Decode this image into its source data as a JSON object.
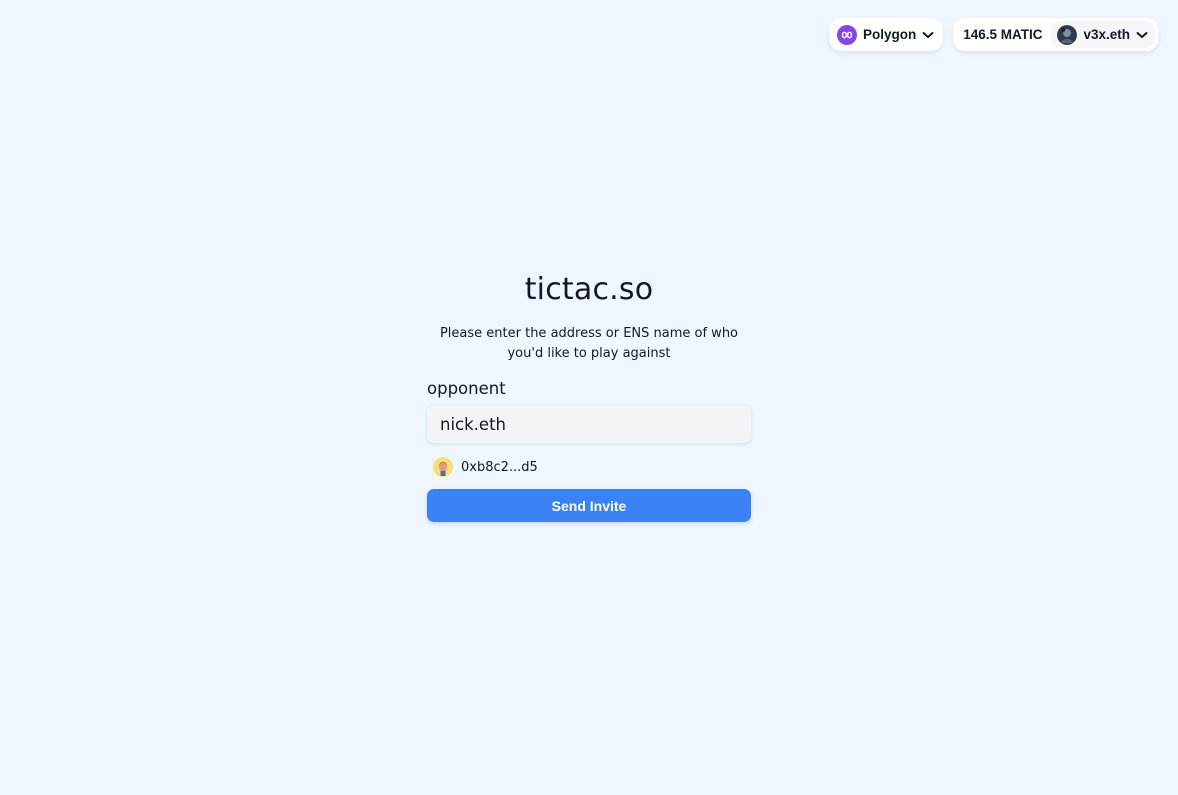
{
  "wallet": {
    "chain_name": "Polygon",
    "chain_icon": "polygon-icon",
    "chain_color": "#8247e5",
    "balance": "146.5 MATIC",
    "account_name": "v3x.eth",
    "account_avatar": "account-avatar"
  },
  "form": {
    "title": "tictac.so",
    "subtitle": "Please enter the address or ENS name of who you'd like to play against",
    "opponent_label": "opponent",
    "opponent_value": "nick.eth",
    "resolved_address": "0xb8c2...d5",
    "resolved_avatar": "ens-avatar",
    "submit_label": "Send Invite"
  },
  "colors": {
    "background": "#eff6ff",
    "accent": "#3b82f6"
  }
}
